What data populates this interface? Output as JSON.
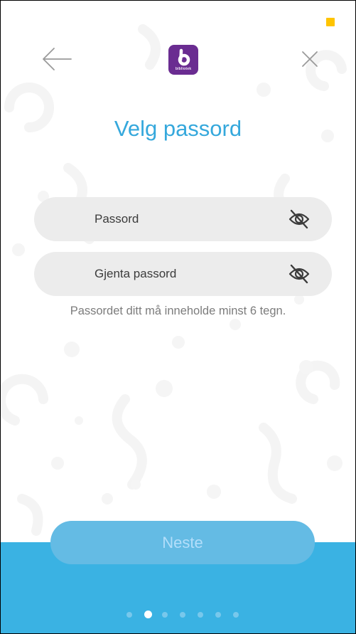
{
  "header": {
    "back_icon": "arrow-left-icon",
    "close_icon": "close-icon",
    "logo_text": "bibliotek",
    "logo_color": "#6a2c91"
  },
  "page": {
    "title": "Velg passord"
  },
  "form": {
    "password": {
      "placeholder": "Passord",
      "value": "",
      "toggle_icon": "eye-off-icon"
    },
    "repeat_password": {
      "placeholder": "Gjenta passord",
      "value": "",
      "toggle_icon": "eye-off-icon"
    },
    "hint": "Passordet ditt må inneholde minst 6 tegn."
  },
  "footer": {
    "next_label": "Neste",
    "page_indicator": {
      "total": 7,
      "current": 2
    }
  },
  "colors": {
    "accent": "#35a8dc",
    "bottom_band": "#3ab2e3",
    "field_bg": "#ececec",
    "status_indicator": "#ffc400"
  }
}
